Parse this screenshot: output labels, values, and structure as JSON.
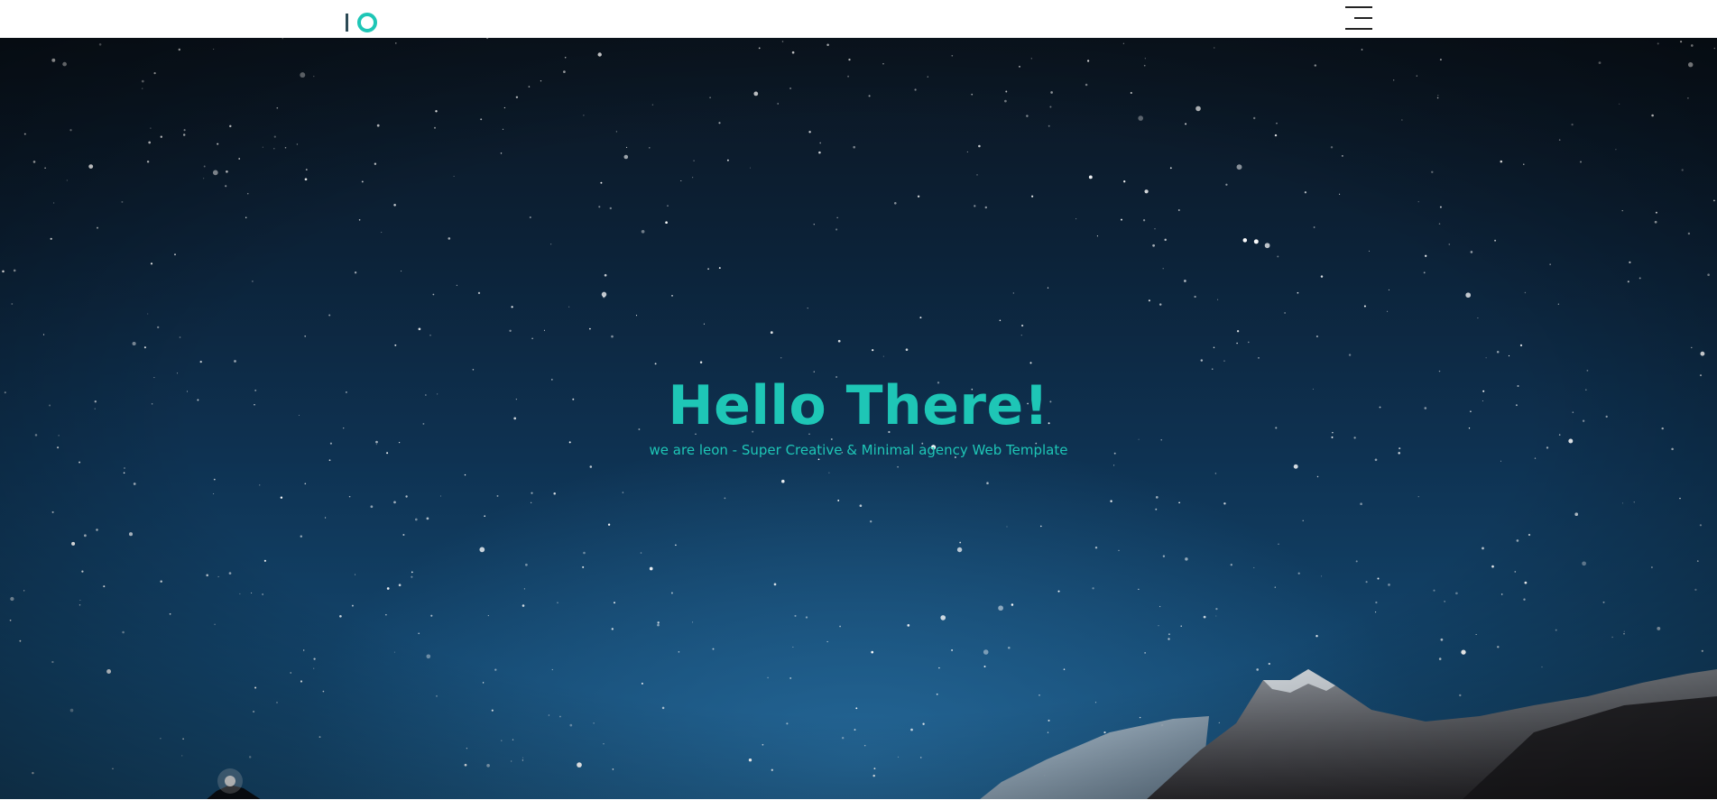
{
  "header": {
    "logo_name": "logo-io",
    "menu_icon": "hamburger-menu-icon"
  },
  "hero": {
    "title": "Hello There!",
    "subtitle": "we are leon - Super Creative & Minimal agency Web Template"
  },
  "colors": {
    "accent": "#1ec6b6",
    "logo_bar": "#2c4a55",
    "header_bg": "#ffffff",
    "sky_top": "#0b1520",
    "sky_bottom": "#184f78"
  }
}
